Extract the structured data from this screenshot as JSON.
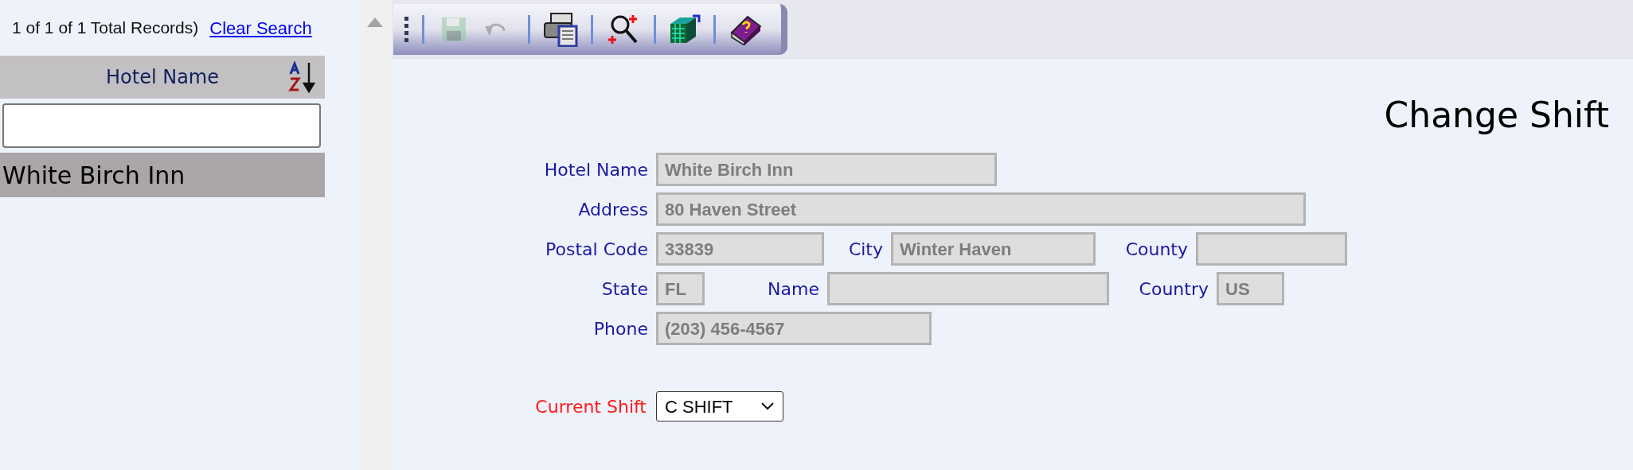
{
  "sidebar": {
    "record_count": "1 of 1 of 1 Total Records)",
    "clear_link": "Clear Search",
    "column_header": "Hotel Name",
    "rows": [
      {
        "label": "White Birch Inn",
        "selected": true
      }
    ]
  },
  "toolbar": {
    "tools": [
      {
        "kind": "grip"
      },
      {
        "kind": "separator"
      },
      {
        "kind": "save",
        "disabled": true
      },
      {
        "kind": "undo",
        "disabled": true
      },
      {
        "kind": "separator"
      },
      {
        "kind": "print",
        "disabled": false
      },
      {
        "kind": "separator"
      },
      {
        "kind": "zoom",
        "disabled": false
      },
      {
        "kind": "separator"
      },
      {
        "kind": "grid",
        "disabled": false
      },
      {
        "kind": "separator"
      },
      {
        "kind": "help",
        "disabled": false
      }
    ]
  },
  "form": {
    "title": "Change Shift",
    "rows": [
      [
        {
          "label": "Hotel Name",
          "value": "White Birch Inn",
          "disabled": true
        }
      ],
      [
        {
          "label": "Address",
          "value": "80 Haven Street",
          "disabled": true
        }
      ],
      [
        {
          "label": "Postal Code",
          "value": "33839",
          "disabled": true
        },
        {
          "label": "City",
          "value": "Winter Haven",
          "disabled": true
        },
        {
          "label": "County",
          "disabled": true
        }
      ],
      [
        {
          "label": "State",
          "value": "FL",
          "disabled": true
        },
        {
          "label": "Name",
          "disabled": true
        },
        {
          "label": "Country",
          "value": "US",
          "disabled": true
        }
      ],
      [
        {
          "label": "Phone",
          "value": "(203) 456-4567",
          "disabled": true
        }
      ]
    ],
    "shift": {
      "label": "Current Shift",
      "value": "C SHIFT",
      "required": true
    }
  }
}
